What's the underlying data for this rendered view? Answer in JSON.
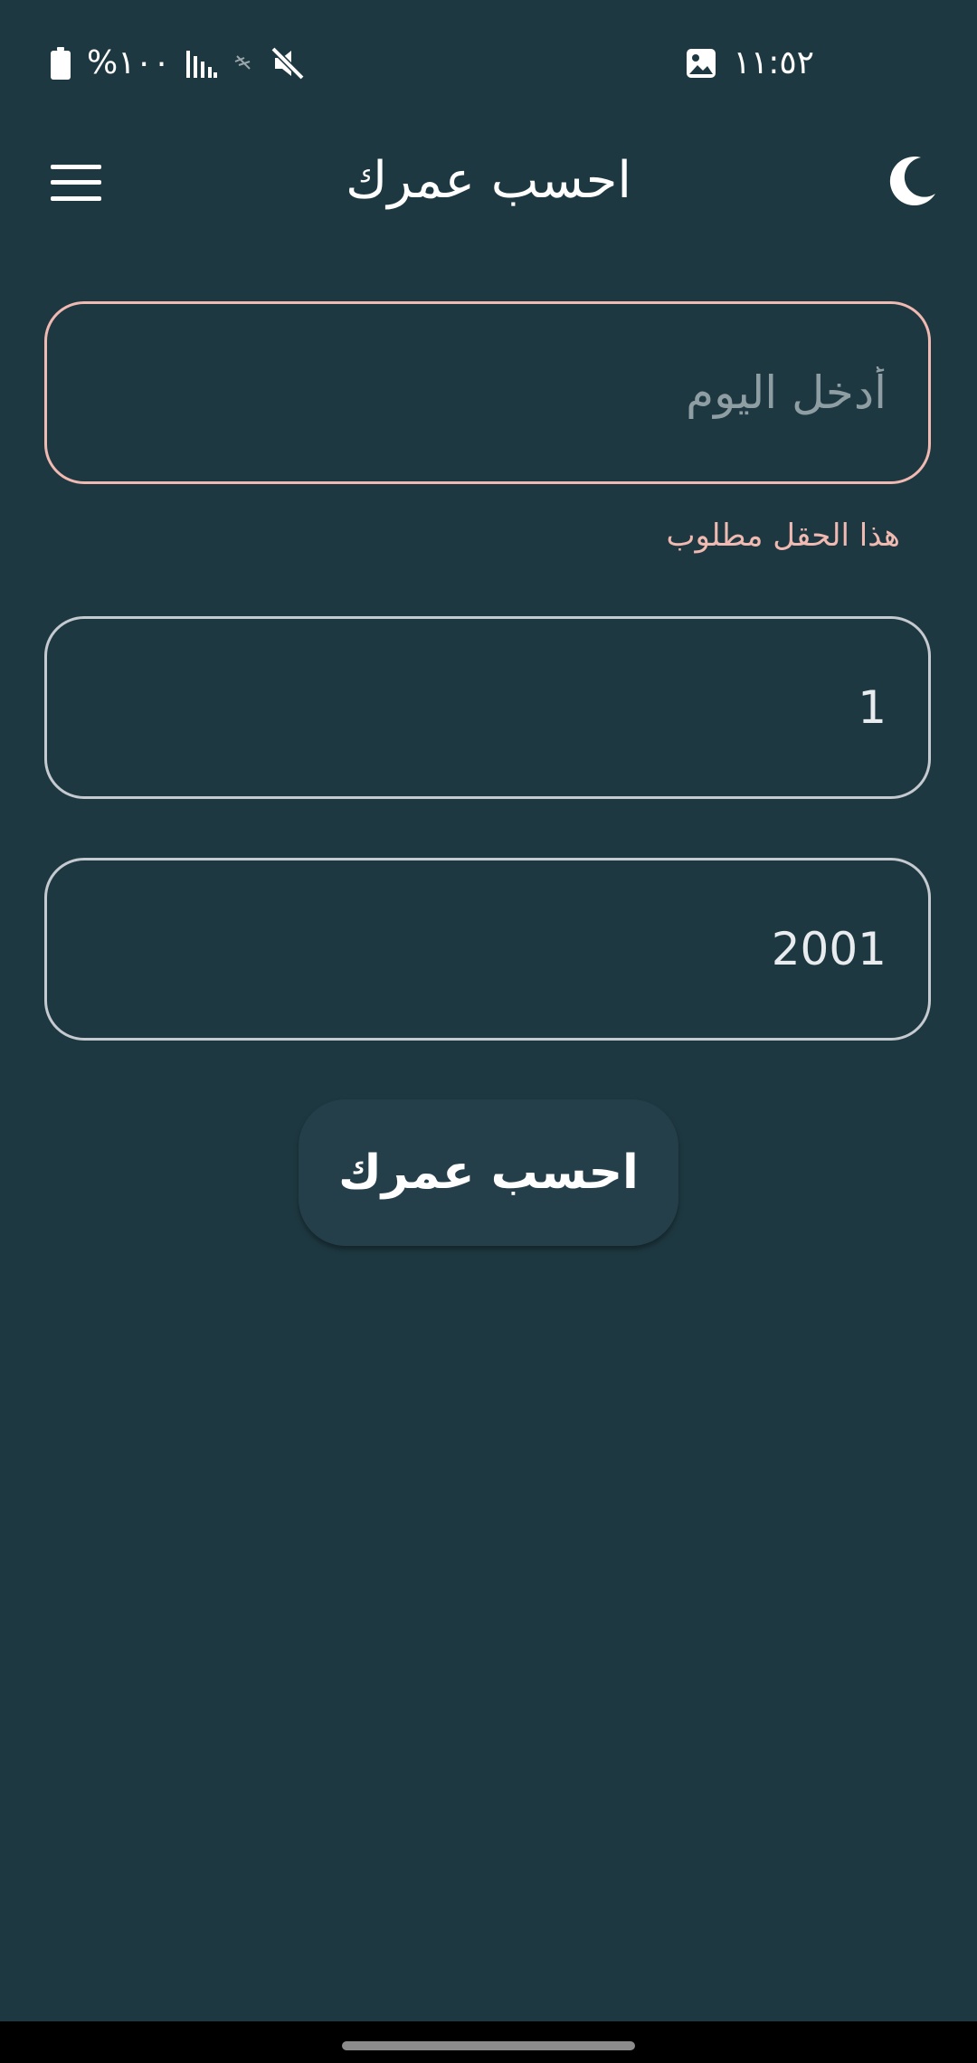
{
  "status_bar": {
    "time": "١١:٥٢",
    "battery": "%١٠٠",
    "icons": [
      "battery-icon",
      "signal-icon",
      "no-data-icon",
      "mute-icon",
      "photo-icon"
    ]
  },
  "app_bar": {
    "title": "احسب عمرك",
    "menu_icon": "menu-icon",
    "theme_icon": "moon-icon"
  },
  "form": {
    "day": {
      "value": "",
      "placeholder": "أدخل اليوم",
      "error": "هذا الحقل مطلوب"
    },
    "month": {
      "value": "1",
      "placeholder": ""
    },
    "year": {
      "value": "2001",
      "placeholder": ""
    },
    "submit_label": "احسب عمرك"
  },
  "colors": {
    "background": "#1e3841",
    "error": "#f0b9b2",
    "field_border": "#c4cad0",
    "button_bg": "#253f4a"
  }
}
